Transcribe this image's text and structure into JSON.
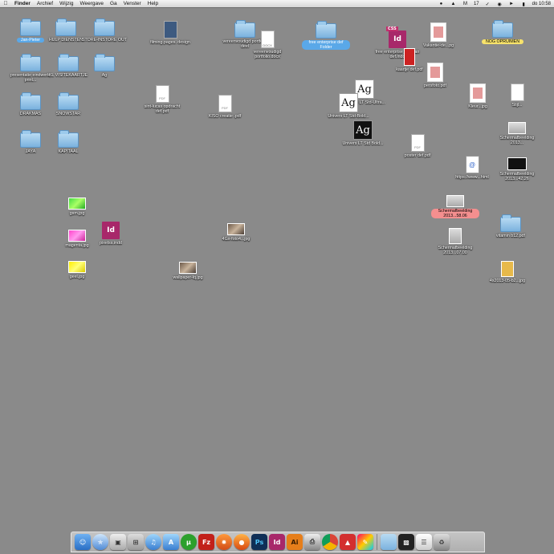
{
  "menubar": {
    "app": "Finder",
    "menus": [
      "Archief",
      "Wijzig",
      "Weergave",
      "Ga",
      "Venster",
      "Help"
    ],
    "badge": "17",
    "clock": "do 10:58"
  },
  "desktop": {
    "jan_pieter": "Jan-Pieter",
    "hulpdiensten": "HULP DIENSTEN",
    "store_instore": "STORE-INSTORE OUT",
    "presentatie": "presentatie eindwerk, print...",
    "visitekaartje": "KL VISITEKAARTJE",
    "ag_folder": "Ag",
    "drakmas": "DRAKMAS",
    "snowstar": "SNOWSTAR",
    "jaya": "JAYA",
    "kapitaal": "KAPITAAL",
    "gsm": "gsm.jpg",
    "pixelss": "pixelss.indd",
    "magenta": "magenta.jpg",
    "geel": "geel.jpg",
    "filmpages": "filming.pages. design",
    "sintlucas": "sint-lucas opdracht def.pdf",
    "cover_pdf": "KISO creatie .pdf",
    "portfolio_pages": "vereenvoudigd portfolio deel",
    "portfolio_docx": "vereenvoudigd portfolio.docx",
    "free_folder": "free enterprise def Folder",
    "univers1": "Univers LT Std-Ultra...",
    "univers2": "Univers LT Std-Bold...",
    "univers3": "Univers LT Std Bold...",
    "vakantie": "Vakantie-de...pg",
    "persfoto": "persfoto.pdf",
    "free_indd": "free enterprise vooraan def.indd",
    "kaartje": "kaartje def.pdf",
    "poster_pdf": "poster def.pdf",
    "stijl": "Stijl...",
    "nog_opruimen": "NOG OPRUIMEN",
    "screenshot1": "Schermafbeelding 2013...",
    "screenshot2": "Schermafbeelding 2013...58.06",
    "screenshot3": "Schermafbeelding 2013...07.00",
    "web": "https://www...html",
    "screen_black": "Schermafbeelding 2013...42.26",
    "vitamin": "vitamin b12.pdf",
    "mail": "Mail",
    "wallpaper": "wallpaper-lq.jpg",
    "photo": "4Gx-foto4...jpg",
    "ofp": "4x2013-05-b2...jpg",
    "ofp2": "28...jpg",
    "kleur": "Kleur...jpg",
    "rood": "rood.jpg"
  },
  "dock": {
    "apps": [
      "Finder",
      "Safari",
      "Preview",
      "Calculator",
      "iTunes",
      "App Store",
      "uTorrent",
      "FileZilla",
      "Spotlight",
      "Firefox",
      "Photoshop",
      "InDesign",
      "Illustrator",
      "Printer",
      "Chrome",
      "Acrobat",
      "Steam",
      "Folder",
      "Screen",
      "Terminal",
      "Trash"
    ],
    "colors": {
      "ps": "#0f2f56",
      "id": "#a8286a",
      "ai": "#e67e1a",
      "fz": "#c2201a",
      "ut": "#2ca02c"
    }
  }
}
